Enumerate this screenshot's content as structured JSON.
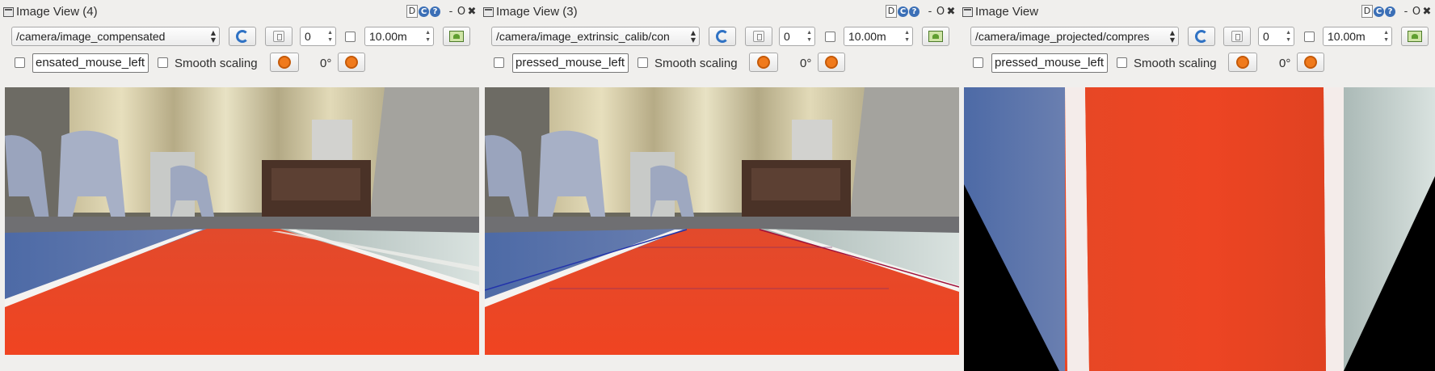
{
  "panels": [
    {
      "title": "Image View (4)",
      "topic": "/camera/image_compensated",
      "frame_value": "0",
      "max_value": "10.00m",
      "mouse_topic": "ensated_mouse_left",
      "smooth_label": "Smooth scaling",
      "rotation": "0°"
    },
    {
      "title": "Image View (3)",
      "topic": "/camera/image_extrinsic_calib/con",
      "frame_value": "0",
      "max_value": "10.00m",
      "mouse_topic": "pressed_mouse_left",
      "smooth_label": "Smooth scaling",
      "rotation": "0°"
    },
    {
      "title": "Image View",
      "topic": "/camera/image_projected/compres",
      "frame_value": "0",
      "max_value": "10.00m",
      "mouse_topic": "pressed_mouse_left",
      "smooth_label": "Smooth scaling",
      "rotation": "0°"
    }
  ],
  "title_controls": {
    "detach": "D",
    "reload": "C",
    "help": "?",
    "minimize": "-",
    "float": "O",
    "close": "✖"
  },
  "colors": {
    "lane_red": "#e8401e",
    "lane_white": "#f4f2ef",
    "carpet_blue": "#5b6f9c",
    "accent_blue": "#2f72c4",
    "rotate_orange": "#f07a1c"
  },
  "icons": [
    "refresh-icon",
    "pause-icon",
    "save-icon",
    "rotate-left-icon",
    "rotate-right-icon"
  ]
}
